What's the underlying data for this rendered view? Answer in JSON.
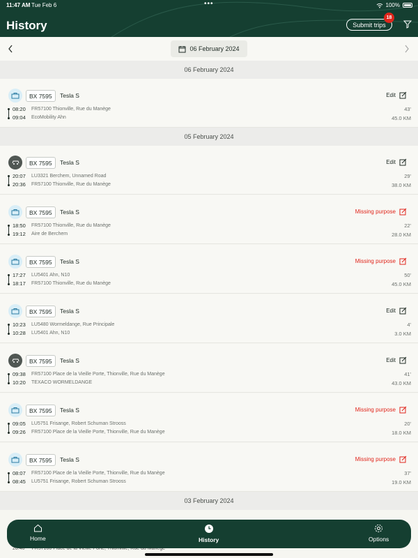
{
  "status_bar": {
    "time": "11:47 AM",
    "date": "Tue Feb 6",
    "battery": "100%",
    "dots": "•••"
  },
  "header": {
    "title": "History",
    "submit_label": "Submit trips",
    "badge_count": "18"
  },
  "date_nav": {
    "current_date": "06 February 2024"
  },
  "groups": [
    {
      "date": "06 February 2024",
      "trips": [
        {
          "type": "business",
          "plate": "BX 7595",
          "car": "Tesla S",
          "action": "Edit",
          "start_time": "08:20",
          "start_loc": "FR57100 Thionville, Rue du Manège",
          "end_time": "09:04",
          "end_loc": "EcoMobility Ahn",
          "duration": "43'",
          "distance": "45.0 KM"
        }
      ]
    },
    {
      "date": "05 February 2024",
      "trips": [
        {
          "type": "private",
          "plate": "BX 7595",
          "car": "Tesla S",
          "action": "Edit",
          "start_time": "20:07",
          "start_loc": "LU3321 Berchem, Unnamed Road",
          "end_time": "20:36",
          "end_loc": "FR57100 Thionville, Rue du Manège",
          "duration": "29'",
          "distance": "38.0 KM"
        },
        {
          "type": "business",
          "plate": "BX 7595",
          "car": "Tesla S",
          "action": "Missing purpose",
          "start_time": "18:50",
          "start_loc": "FR57100 Thionville, Rue du Manège",
          "end_time": "19:12",
          "end_loc": "Aire de Berchem",
          "duration": "22'",
          "distance": "28.0 KM"
        },
        {
          "type": "business",
          "plate": "BX 7595",
          "car": "Tesla S",
          "action": "Missing purpose",
          "start_time": "17:27",
          "start_loc": "LU5401 Ahn, N10",
          "end_time": "18:17",
          "end_loc": "FR57100 Thionville, Rue du Manège",
          "duration": "50'",
          "distance": "45.0 KM"
        },
        {
          "type": "business",
          "plate": "BX 7595",
          "car": "Tesla S",
          "action": "Edit",
          "start_time": "10:23",
          "start_loc": "LU5480 Wormeldange, Rue Principale",
          "end_time": "10:28",
          "end_loc": "LU5401 Ahn, N10",
          "duration": "4'",
          "distance": "3.0 KM"
        },
        {
          "type": "private",
          "plate": "BX 7595",
          "car": "Tesla S",
          "action": "Edit",
          "start_time": "09:38",
          "start_loc": "FR57100 Place de la Vieille Porte, Thionville, Rue du Manège",
          "end_time": "10:20",
          "end_loc": "TEXACO WORMELDANGE",
          "duration": "41'",
          "distance": "43.0 KM"
        },
        {
          "type": "business",
          "plate": "BX 7595",
          "car": "Tesla S",
          "action": "Missing purpose",
          "start_time": "09:05",
          "start_loc": "LU5751 Frisange, Robert Schuman Strooss",
          "end_time": "09:26",
          "end_loc": "FR57100 Place de la Vieille Porte, Thionville, Rue du Manège",
          "duration": "20'",
          "distance": "18.0 KM"
        },
        {
          "type": "business",
          "plate": "BX 7595",
          "car": "Tesla S",
          "action": "Missing purpose",
          "start_time": "08:07",
          "start_loc": "FR57100 Place de la Vieille Porte, Thionville, Rue du Manège",
          "end_time": "08:45",
          "end_loc": "LU5751 Frisange, Robert Schuman Strooss",
          "duration": "37'",
          "distance": "19.0 KM"
        }
      ]
    },
    {
      "date": "03 February 2024",
      "trips": []
    }
  ],
  "peek_row": {
    "time": "20:40",
    "loc": "FR57100 Place de la Vieille Porte, Thionville, Rue du Manège"
  },
  "bottom_nav": {
    "home": "Home",
    "history": "History",
    "options": "Options"
  },
  "colors": {
    "brand": "#153f31",
    "missing": "#e0251b",
    "business_icon_bg": "#d9eef7",
    "private_icon_bg": "#505753"
  }
}
